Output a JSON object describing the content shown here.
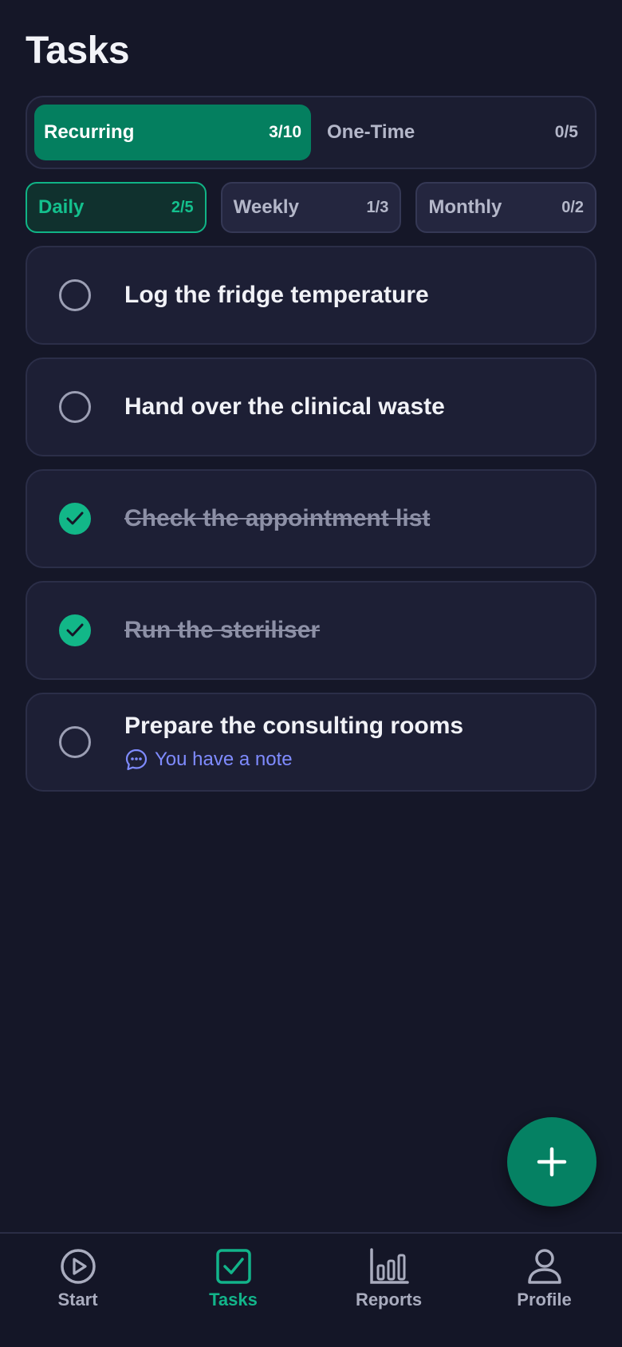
{
  "header": {
    "title": "Tasks"
  },
  "type_tabs": [
    {
      "label": "Recurring",
      "count": "3/10",
      "active": true
    },
    {
      "label": "One-Time",
      "count": "0/5",
      "active": false
    }
  ],
  "period_tabs": [
    {
      "label": "Daily",
      "count": "2/5",
      "active": true
    },
    {
      "label": "Weekly",
      "count": "1/3",
      "active": false
    },
    {
      "label": "Monthly",
      "count": "0/2",
      "active": false
    }
  ],
  "tasks": [
    {
      "title": "Log the fridge temperature",
      "done": false
    },
    {
      "title": "Hand over the clinical waste",
      "done": false
    },
    {
      "title": "Check the appointment list",
      "done": true
    },
    {
      "title": "Run the steriliser",
      "done": true
    },
    {
      "title": "Prepare the consulting rooms",
      "done": false,
      "note": "You have a note"
    }
  ],
  "fab": {
    "icon": "plus-icon"
  },
  "bottom_nav": [
    {
      "label": "Start",
      "icon": "play-circle-icon",
      "active": false
    },
    {
      "label": "Tasks",
      "icon": "checkbox-icon",
      "active": true
    },
    {
      "label": "Reports",
      "icon": "bar-chart-icon",
      "active": false
    },
    {
      "label": "Profile",
      "icon": "person-icon",
      "active": false
    }
  ],
  "colors": {
    "background": "#151728",
    "accent": "#047f5f",
    "accent_text": "#14c08d",
    "note": "#7f8bff"
  }
}
